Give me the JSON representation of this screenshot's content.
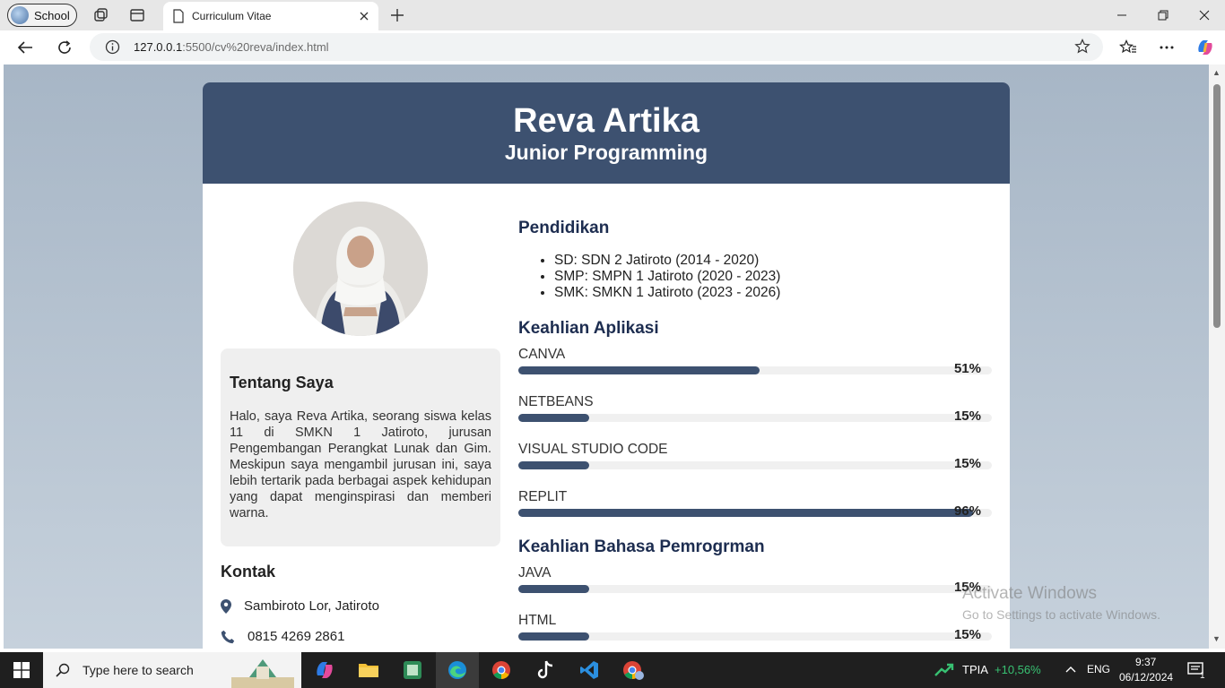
{
  "browser": {
    "profile_name": "School",
    "tab_title": "Curriculum Vitae",
    "url_host": "127.0.0.1",
    "url_path": ":5500/cv%20reva/index.html"
  },
  "cv": {
    "name": "Reva Artika",
    "role": "Junior Programming",
    "about_title": "Tentang Saya",
    "about_text": "Halo, saya Reva Artika, seorang siswa kelas 11 di SMKN 1 Jatiroto, jurusan Pengembangan Perangkat Lunak dan Gim. Meskipun saya mengambil jurusan ini, saya lebih tertarik pada berbagai aspek kehidupan yang dapat menginspirasi dan memberi warna.",
    "contact_title": "Kontak",
    "contact_address": "Sambiroto Lor, Jatiroto",
    "contact_phone": "0815 4269 2861",
    "education_title": "Pendidikan",
    "education": [
      "SD: SDN 2 Jatiroto (2014 - 2020)",
      "SMP: SMPN 1 Jatiroto (2020 - 2023)",
      "SMK: SMKN 1 Jatiroto (2023 - 2026)"
    ],
    "app_skills_title": "Keahlian Aplikasi",
    "app_skills": [
      {
        "name": "CANVA",
        "percent": 51,
        "label": "51%"
      },
      {
        "name": "NETBEANS",
        "percent": 15,
        "label": "15%"
      },
      {
        "name": "VISUAL STUDIO CODE",
        "percent": 15,
        "label": "15%"
      },
      {
        "name": "REPLIT",
        "percent": 96,
        "label": "96%"
      }
    ],
    "lang_skills_title": "Keahlian Bahasa Pemrogrman",
    "lang_skills": [
      {
        "name": "JAVA",
        "percent": 15,
        "label": "15%"
      },
      {
        "name": "HTML",
        "percent": 15,
        "label": "15%"
      }
    ]
  },
  "watermark": {
    "line1": "Activate Windows",
    "line2": "Go to Settings to activate Windows."
  },
  "taskbar": {
    "search_placeholder": "Type here to search",
    "stock_name": "TPIA",
    "stock_change": "+10,56%",
    "language": "ENG",
    "time": "9:37",
    "date": "06/12/2024",
    "notification_count": "1"
  },
  "colors": {
    "header": "#3d5170",
    "bar_fill": "#3d5170",
    "page_bg_top": "#a7b6c6",
    "taskbar": "#1f1f1f"
  }
}
